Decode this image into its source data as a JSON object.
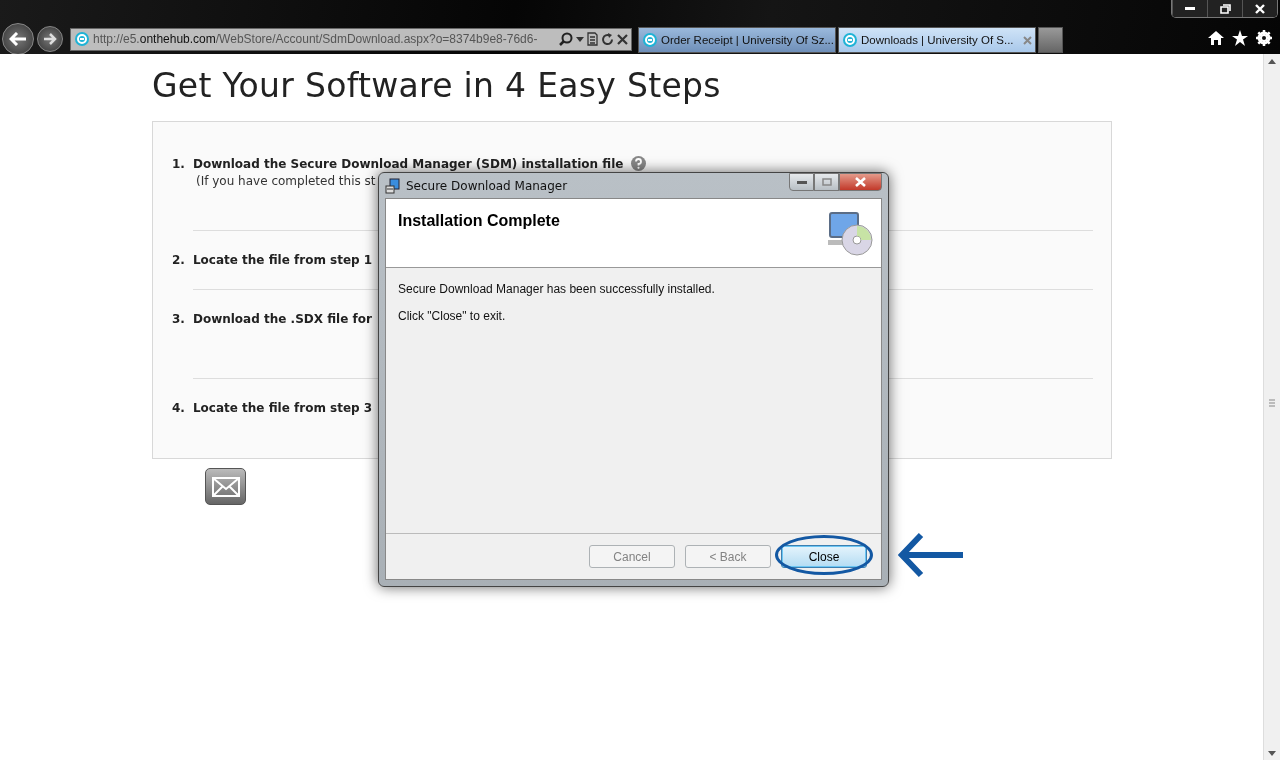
{
  "browser": {
    "address": {
      "prefix": "http://e5.",
      "domain": "onthehub.com",
      "path": "/WebStore/Account/SdmDownload.aspx?o=8374b9e8-76d6-"
    },
    "tabs": [
      {
        "label": "Order Receipt | University Of Sz...",
        "selected": false
      },
      {
        "label": "Downloads | University Of S...",
        "selected": true
      }
    ]
  },
  "page": {
    "title": "Get Your Software in 4 Easy Steps",
    "steps": [
      {
        "number": "1.",
        "text": "Download the Secure Download Manager (SDM) installation file",
        "note": "(If you have completed this st",
        "help": true
      },
      {
        "number": "2.",
        "text": "Locate the file from step 1",
        "help": false
      },
      {
        "number": "3.",
        "text": "Download the .SDX file for",
        "help": false
      },
      {
        "number": "4.",
        "text": "Locate the file from step 3",
        "help": false
      }
    ]
  },
  "dialog": {
    "title": "Secure Download Manager",
    "heading": "Installation Complete",
    "messages": [
      "Secure Download Manager has been successfully installed.",
      "Click \"Close\" to exit."
    ],
    "buttons": [
      {
        "label": "Cancel",
        "disabled": true,
        "focused": false
      },
      {
        "label": "< Back",
        "disabled": true,
        "focused": false
      },
      {
        "label": "Close",
        "disabled": false,
        "focused": true
      }
    ]
  }
}
